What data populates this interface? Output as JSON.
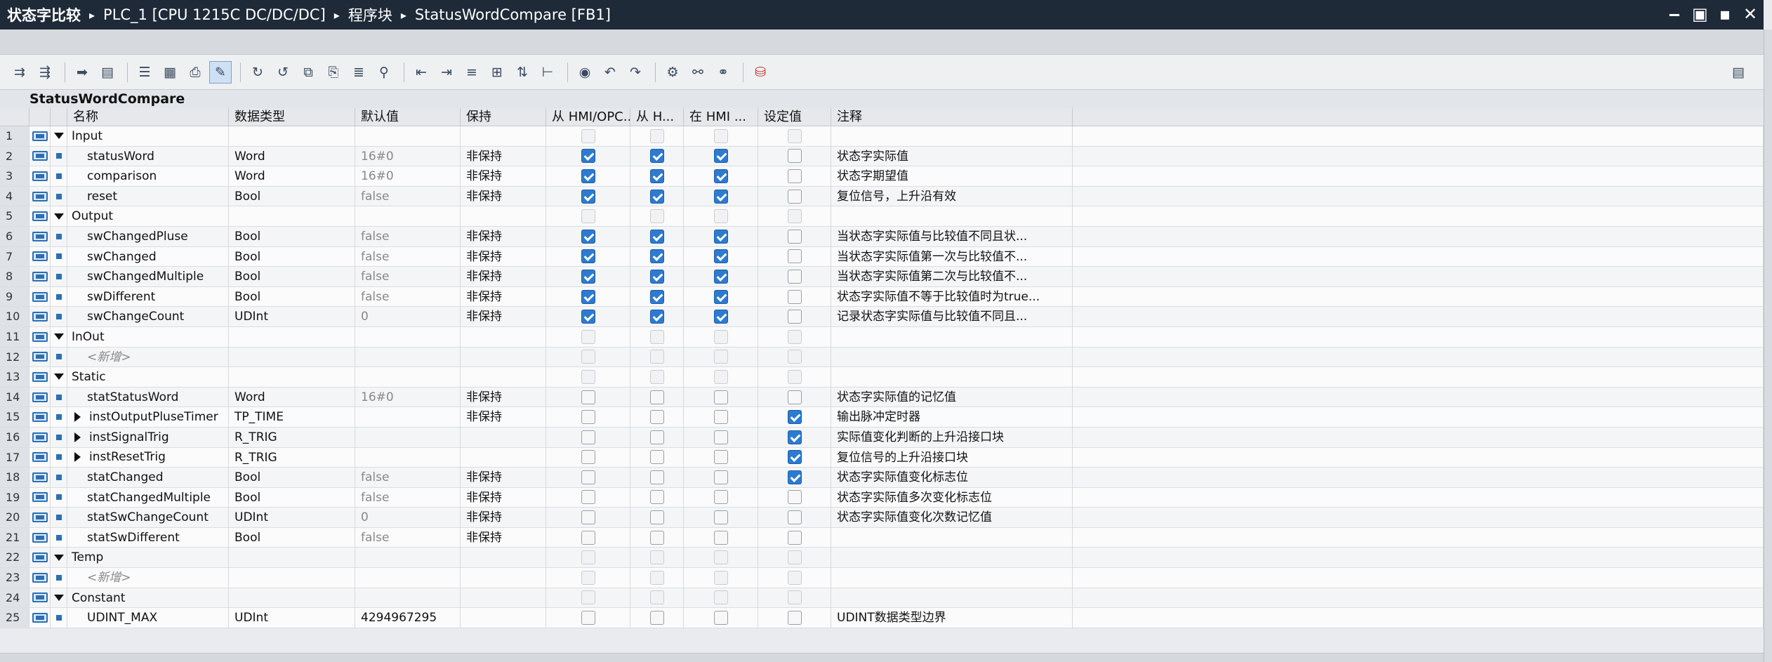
{
  "breadcrumb": [
    "状态字比较",
    "PLC_1 [CPU 1215C DC/DC/DC]",
    "程序块",
    "StatusWordCompare [FB1]"
  ],
  "window_controls": {
    "minimize": "‒",
    "restore": "▣",
    "maximize": "▪",
    "close": "✕"
  },
  "toolbar_icons": [
    "insert-row-icon",
    "add-row-icon",
    "go-to-icon",
    "monitor-icon",
    "expand-all-icon",
    "collapse-all-icon",
    "snapshot-icon",
    "apply-icon",
    "hmi-icon",
    "settings-icon"
  ],
  "block_name": "StatusWordCompare",
  "columns": {
    "name": "名称",
    "type": "数据类型",
    "default": "默认值",
    "retain": "保持",
    "hmi_opc": "从 HMI/OPC...",
    "from_h": "从 H...",
    "in_hmi": "在 HMI ...",
    "setpoint": "设定值",
    "comment": "注释"
  },
  "rows": [
    {
      "n": "1",
      "sec": true,
      "name": "Input",
      "type": "",
      "def": "",
      "ret": "",
      "c1": 0,
      "c2": 0,
      "c3": 0,
      "s": 0,
      "cmt": "",
      "dim": true
    },
    {
      "n": "2",
      "name": "statusWord",
      "type": "Word",
      "def": "16#0",
      "ret": "非保持",
      "c1": 1,
      "c2": 1,
      "c3": 1,
      "s": 0,
      "cmt": "状态字实际值"
    },
    {
      "n": "3",
      "name": "comparison",
      "type": "Word",
      "def": "16#0",
      "ret": "非保持",
      "c1": 1,
      "c2": 1,
      "c3": 1,
      "s": 0,
      "cmt": "状态字期望值"
    },
    {
      "n": "4",
      "name": "reset",
      "type": "Bool",
      "def": "false",
      "ret": "非保持",
      "c1": 1,
      "c2": 1,
      "c3": 1,
      "s": 0,
      "cmt": "复位信号，上升沿有效"
    },
    {
      "n": "5",
      "sec": true,
      "name": "Output",
      "type": "",
      "def": "",
      "ret": "",
      "c1": 0,
      "c2": 0,
      "c3": 0,
      "s": 0,
      "cmt": "",
      "dim": true
    },
    {
      "n": "6",
      "name": "swChangedPluse",
      "type": "Bool",
      "def": "false",
      "ret": "非保持",
      "c1": 1,
      "c2": 1,
      "c3": 1,
      "s": 0,
      "cmt": "当状态字实际值与比较值不同且状..."
    },
    {
      "n": "7",
      "name": "swChanged",
      "type": "Bool",
      "def": "false",
      "ret": "非保持",
      "c1": 1,
      "c2": 1,
      "c3": 1,
      "s": 0,
      "cmt": "当状态字实际值第一次与比较值不..."
    },
    {
      "n": "8",
      "name": "swChangedMultiple",
      "type": "Bool",
      "def": "false",
      "ret": "非保持",
      "c1": 1,
      "c2": 1,
      "c3": 1,
      "s": 0,
      "cmt": "当状态字实际值第二次与比较值不..."
    },
    {
      "n": "9",
      "name": "swDifferent",
      "type": "Bool",
      "def": "false",
      "ret": "非保持",
      "c1": 1,
      "c2": 1,
      "c3": 1,
      "s": 0,
      "cmt": "状态字实际值不等于比较值时为true..."
    },
    {
      "n": "10",
      "name": "swChangeCount",
      "type": "UDInt",
      "def": "0",
      "ret": "非保持",
      "c1": 1,
      "c2": 1,
      "c3": 1,
      "s": 0,
      "cmt": "记录状态字实际值与比较值不同且..."
    },
    {
      "n": "11",
      "sec": true,
      "name": "InOut",
      "type": "",
      "def": "",
      "ret": "",
      "c1": 0,
      "c2": 0,
      "c3": 0,
      "s": 0,
      "cmt": "",
      "dim": true
    },
    {
      "n": "12",
      "ph": true,
      "name": "<新增>",
      "type": "",
      "def": "",
      "ret": "",
      "c1": 0,
      "c2": 0,
      "c3": 0,
      "s": 0,
      "cmt": "",
      "dim": true
    },
    {
      "n": "13",
      "sec": true,
      "name": "Static",
      "type": "",
      "def": "",
      "ret": "",
      "c1": 0,
      "c2": 0,
      "c3": 0,
      "s": 0,
      "cmt": "",
      "dim": true
    },
    {
      "n": "14",
      "name": "statStatusWord",
      "type": "Word",
      "def": "16#0",
      "ret": "非保持",
      "c1": 0,
      "c2": 0,
      "c3": 0,
      "s": 0,
      "cmt": "状态字实际值的记忆值"
    },
    {
      "n": "15",
      "exp": true,
      "name": "instOutputPluseTimer",
      "type": "TP_TIME",
      "def": "",
      "ret": "非保持",
      "c1": 0,
      "c2": 0,
      "c3": 0,
      "s": 1,
      "cmt": "输出脉冲定时器"
    },
    {
      "n": "16",
      "exp": true,
      "name": "instSignalTrig",
      "type": "R_TRIG",
      "def": "",
      "ret": "",
      "c1": 0,
      "c2": 0,
      "c3": 0,
      "s": 1,
      "cmt": "实际值变化判断的上升沿接口块"
    },
    {
      "n": "17",
      "exp": true,
      "name": "instResetTrig",
      "type": "R_TRIG",
      "def": "",
      "ret": "",
      "c1": 0,
      "c2": 0,
      "c3": 0,
      "s": 1,
      "cmt": "复位信号的上升沿接口块"
    },
    {
      "n": "18",
      "name": "statChanged",
      "type": "Bool",
      "def": "false",
      "ret": "非保持",
      "c1": 0,
      "c2": 0,
      "c3": 0,
      "s": 1,
      "cmt": "状态字实际值变化标志位"
    },
    {
      "n": "19",
      "name": "statChangedMultiple",
      "type": "Bool",
      "def": "false",
      "ret": "非保持",
      "c1": 0,
      "c2": 0,
      "c3": 0,
      "s": 0,
      "cmt": "状态字实际值多次变化标志位"
    },
    {
      "n": "20",
      "name": "statSwChangeCount",
      "type": "UDInt",
      "def": "0",
      "ret": "非保持",
      "c1": 0,
      "c2": 0,
      "c3": 0,
      "s": 0,
      "cmt": "状态字实际值变化次数记忆值"
    },
    {
      "n": "21",
      "name": "statSwDifferent",
      "type": "Bool",
      "def": "false",
      "ret": "非保持",
      "c1": 0,
      "c2": 0,
      "c3": 0,
      "s": 0,
      "cmt": ""
    },
    {
      "n": "22",
      "sec": true,
      "name": "Temp",
      "type": "",
      "def": "",
      "ret": "",
      "c1": 0,
      "c2": 0,
      "c3": 0,
      "s": 0,
      "cmt": "",
      "dim": true
    },
    {
      "n": "23",
      "ph": true,
      "name": "<新增>",
      "type": "",
      "def": "",
      "ret": "",
      "c1": 0,
      "c2": 0,
      "c3": 0,
      "s": 0,
      "cmt": "",
      "dim": true
    },
    {
      "n": "24",
      "sec": true,
      "name": "Constant",
      "type": "",
      "def": "",
      "ret": "",
      "c1": 0,
      "c2": 0,
      "c3": 0,
      "s": 0,
      "cmt": "",
      "dim": true
    },
    {
      "n": "25",
      "name": "UDINT_MAX",
      "type": "UDInt",
      "def": "4294967295",
      "defDark": true,
      "ret": "",
      "c1": 0,
      "c2": 0,
      "c3": 0,
      "s": 0,
      "cmt": "UDINT数据类型边界"
    }
  ]
}
